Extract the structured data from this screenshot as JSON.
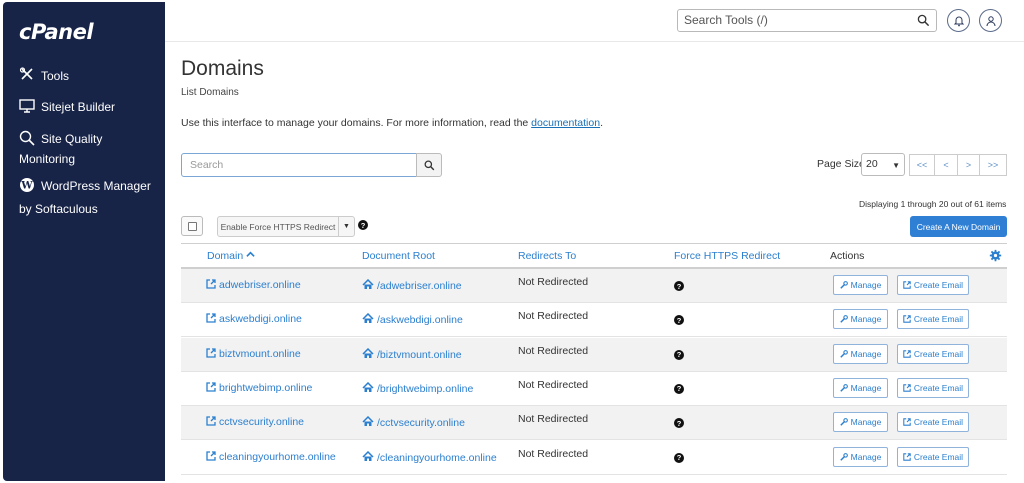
{
  "app": {
    "logo": "cPanel"
  },
  "sidebar": {
    "items": [
      {
        "label": "Tools",
        "icon": "tools-icon"
      },
      {
        "label": "Sitejet Builder",
        "icon": "monitor-icon"
      },
      {
        "label": "Site Quality",
        "label2": "Monitoring",
        "icon": "search-quality-icon"
      },
      {
        "label": "WordPress Manager",
        "label2": "by Softaculous",
        "icon": "wordpress-icon"
      }
    ]
  },
  "topbar": {
    "search_placeholder": "Search Tools (/)"
  },
  "page": {
    "title": "Domains",
    "subtitle": "List Domains",
    "description": "Use this interface to manage your domains. For more information, read the ",
    "doc_link": "documentation",
    "doc_suffix": "."
  },
  "toolbar": {
    "search_placeholder": "Search",
    "page_size_label": "Page Size",
    "page_size_value": "20",
    "pager": [
      "<<",
      "<",
      ">",
      ">>"
    ],
    "displaying": "Displaying 1 through 20 out of 61 items",
    "force_https_btn": "Enable Force HTTPS Redirect",
    "create_btn": "Create A New Domain"
  },
  "table": {
    "headers": {
      "domain": "Domain",
      "document_root": "Document Root",
      "redirects_to": "Redirects To",
      "force_https": "Force HTTPS Redirect",
      "actions": "Actions"
    },
    "manage_label": "Manage",
    "create_email_label": "Create Email",
    "rows": [
      {
        "domain": "adwebriser.online",
        "root": "/adwebriser.online",
        "redirect": "Not Redirected"
      },
      {
        "domain": "askwebdigi.online",
        "root": "/askwebdigi.online",
        "redirect": "Not Redirected"
      },
      {
        "domain": "biztvmount.online",
        "root": "/biztvmount.online",
        "redirect": "Not Redirected"
      },
      {
        "domain": "brightwebimp.online",
        "root": "/brightwebimp.online",
        "redirect": "Not Redirected"
      },
      {
        "domain": "cctvsecurity.online",
        "root": "/cctvsecurity.online",
        "redirect": "Not Redirected"
      },
      {
        "domain": "cleaningyourhome.online",
        "root": "/cleaningyourhome.online",
        "redirect": "Not Redirected"
      }
    ]
  },
  "colors": {
    "sidebar": "#172347",
    "link": "#2b7fcf",
    "primary": "#2f7fd4"
  }
}
